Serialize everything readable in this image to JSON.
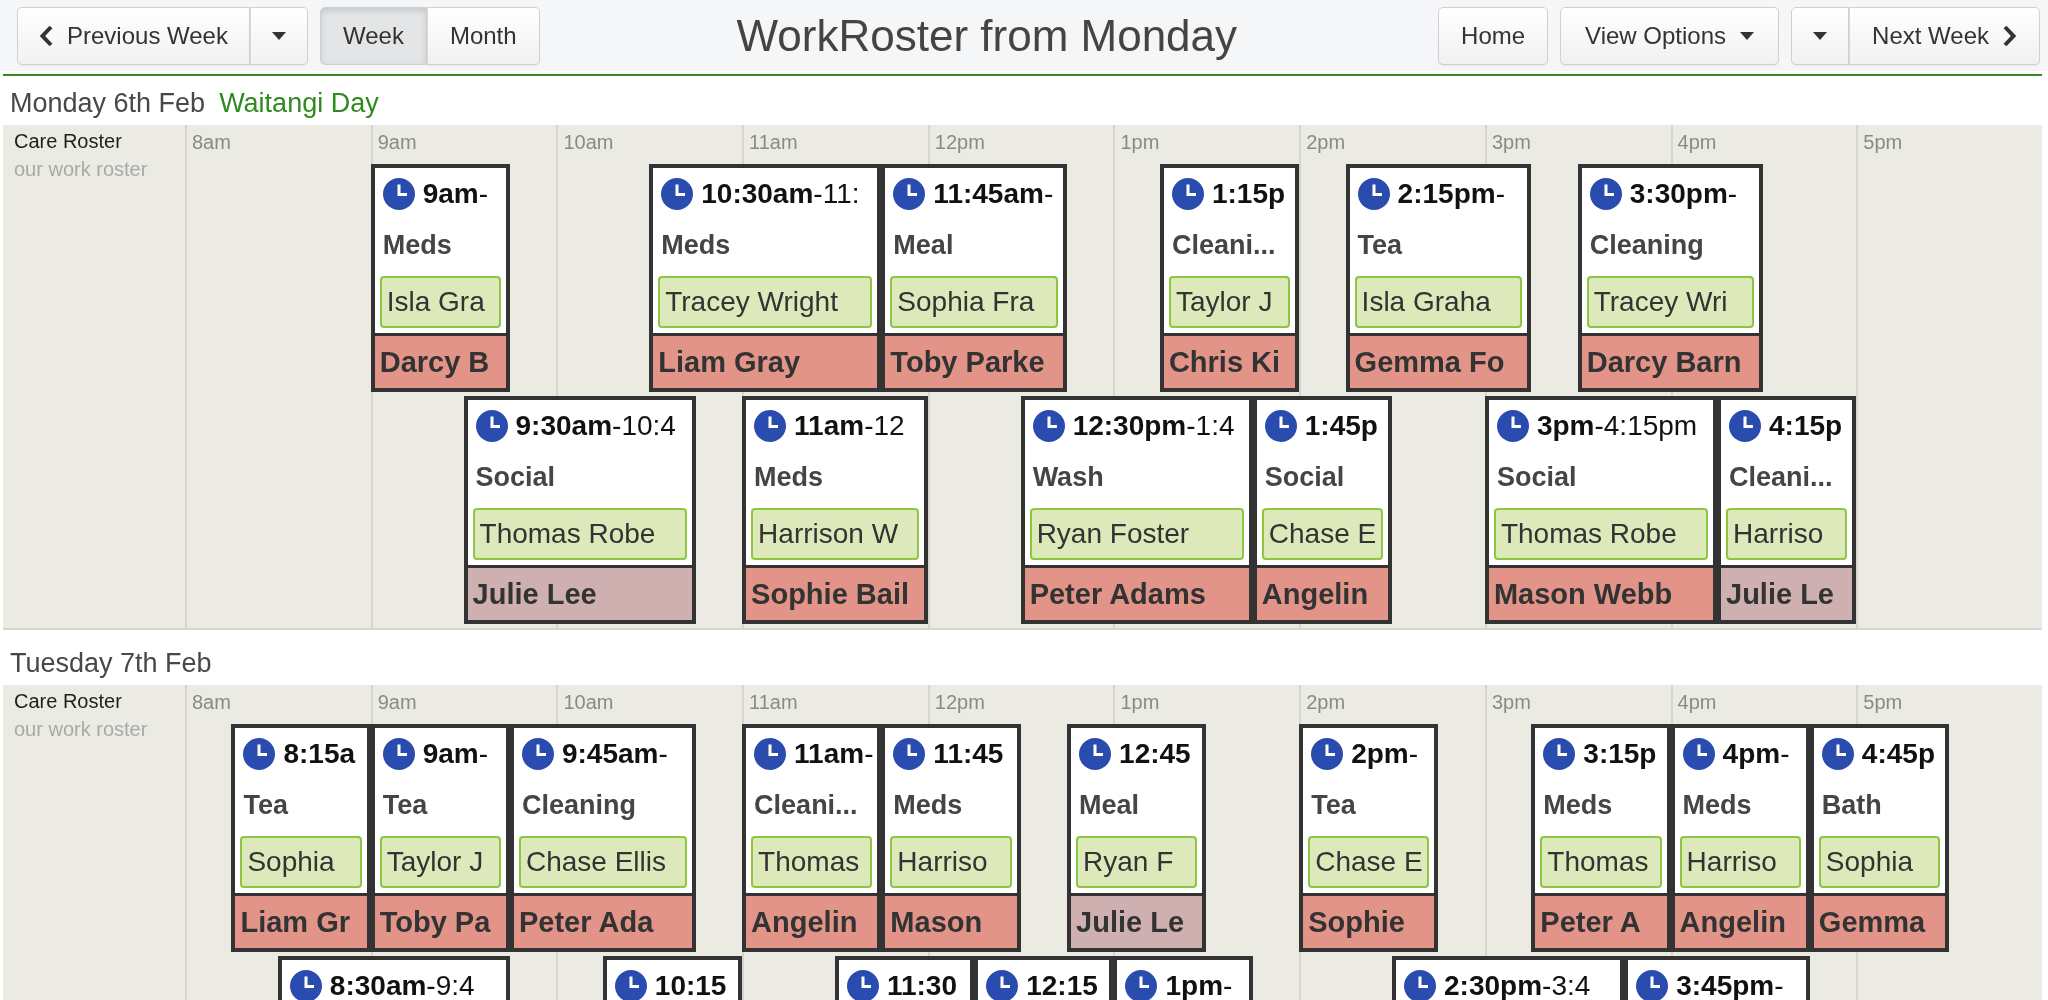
{
  "toolbar": {
    "previous": "Previous Week",
    "views": [
      {
        "label": "Week",
        "selected": true
      },
      {
        "label": "Month",
        "selected": false
      }
    ],
    "title": "WorkRoster from Monday",
    "home": "Home",
    "view_options": "View Options",
    "next": "Next Week"
  },
  "days": [
    {
      "date": "Monday 6th Feb",
      "holiday": "Waitangi Day",
      "roster": {
        "name": "Care Roster",
        "description": "our work roster"
      },
      "hours": [
        "8am",
        "9am",
        "10am",
        "11am",
        "12pm",
        "1pm",
        "2pm",
        "3pm",
        "4pm",
        "5pm"
      ],
      "lanes": [
        [
          {
            "start": "9am",
            "end": "-",
            "task": "Meds",
            "staff": "Isla Gra",
            "resident": "Darcy B",
            "color": "#e39488"
          },
          {
            "start": "10:30am",
            "end": "-11:",
            "task": "Meds",
            "staff": "Tracey Wright",
            "resident": "Liam Gray",
            "color": "#e39488"
          },
          {
            "start": "11:45am",
            "end": "-",
            "task": "Meal",
            "staff": "Sophia Fra",
            "resident": "Toby Parke",
            "color": "#e39488"
          },
          {
            "start": "1:15p",
            "task": "Cleani...",
            "staff": "Taylor J",
            "resident": "Chris Ki",
            "color": "#e39488"
          },
          {
            "start": "2:15pm",
            "end": "-",
            "task": "Tea",
            "staff": "Isla Graha",
            "resident": "Gemma Fo",
            "color": "#e39488"
          },
          {
            "start": "3:30pm",
            "end": "-",
            "task": "Cleaning",
            "staff": "Tracey Wri",
            "resident": "Darcy Barn",
            "color": "#e39488"
          }
        ],
        [
          {
            "start": "9:30am",
            "end": "-10:4",
            "task": "Social",
            "staff": "Thomas Robe",
            "resident": "Julie Lee",
            "color": "#cfb0b0"
          },
          {
            "start": "11am",
            "end": "-12",
            "task": "Meds",
            "staff": "Harrison W",
            "resident": "Sophie Bail",
            "color": "#e39488"
          },
          {
            "start": "12:30pm",
            "end": "-1:4",
            "task": "Wash",
            "staff": "Ryan Foster",
            "resident": "Peter Adams",
            "color": "#e39488"
          },
          {
            "start": "1:45p",
            "task": "Social",
            "staff": "Chase E",
            "resident": "Angelin",
            "color": "#e39488"
          },
          {
            "start": "3pm",
            "end": "-4:15pm",
            "task": "Social",
            "staff": "Thomas Robe",
            "resident": "Mason Webb",
            "color": "#e39488"
          },
          {
            "start": "4:15p",
            "task": "Cleani...",
            "staff": "Harriso",
            "resident": "Julie Le",
            "color": "#cfb0b0"
          }
        ]
      ]
    },
    {
      "date": "Tuesday 7th Feb",
      "roster": {
        "name": "Care Roster",
        "description": "our work roster"
      },
      "hours": [
        "8am",
        "9am",
        "10am",
        "11am",
        "12pm",
        "1pm",
        "2pm",
        "3pm",
        "4pm",
        "5pm"
      ],
      "lanes": [
        [
          {
            "start": "8:15a",
            "task": "Tea",
            "staff": "Sophia",
            "resident": "Liam Gr",
            "color": "#e39488"
          },
          {
            "start": "9am",
            "end": "-",
            "task": "Tea",
            "staff": "Taylor J",
            "resident": "Toby Pa",
            "color": "#e39488"
          },
          {
            "start": "9:45am",
            "end": "-",
            "task": "Cleaning",
            "staff": "Chase Ellis",
            "resident": "Peter Ada",
            "color": "#e39488"
          },
          {
            "start": "11am",
            "end": "-",
            "task": "Cleani...",
            "staff": "Thomas",
            "resident": "Angelin",
            "color": "#e39488"
          },
          {
            "start": "11:45",
            "task": "Meds",
            "staff": "Harriso",
            "resident": "Mason",
            "color": "#e39488"
          },
          {
            "start": "12:45",
            "task": "Meal",
            "staff": "Ryan F",
            "resident": "Julie Le",
            "color": "#cfb0b0"
          },
          {
            "start": "2pm",
            "end": "-",
            "task": "Tea",
            "staff": "Chase E",
            "resident": "Sophie",
            "color": "#e39488"
          },
          {
            "start": "3:15p",
            "task": "Meds",
            "staff": "Thomas",
            "resident": "Peter A",
            "color": "#e39488"
          },
          {
            "start": "4pm",
            "end": "-",
            "task": "Meds",
            "staff": "Harriso",
            "resident": "Angelin",
            "color": "#e39488"
          },
          {
            "start": "4:45p",
            "task": "Bath",
            "staff": "Sophia",
            "resident": "Gemma",
            "color": "#e39488"
          }
        ],
        [
          {
            "start": "8:30am",
            "end": "-9:4"
          },
          {
            "start": "10:15"
          },
          {
            "start": "11:30"
          },
          {
            "start": "12:15"
          },
          {
            "start": "1pm",
            "end": "-"
          },
          {
            "start": "2:30pm",
            "end": "-3:4"
          },
          {
            "start": "3:45pm",
            "end": "-"
          }
        ]
      ]
    }
  ]
}
